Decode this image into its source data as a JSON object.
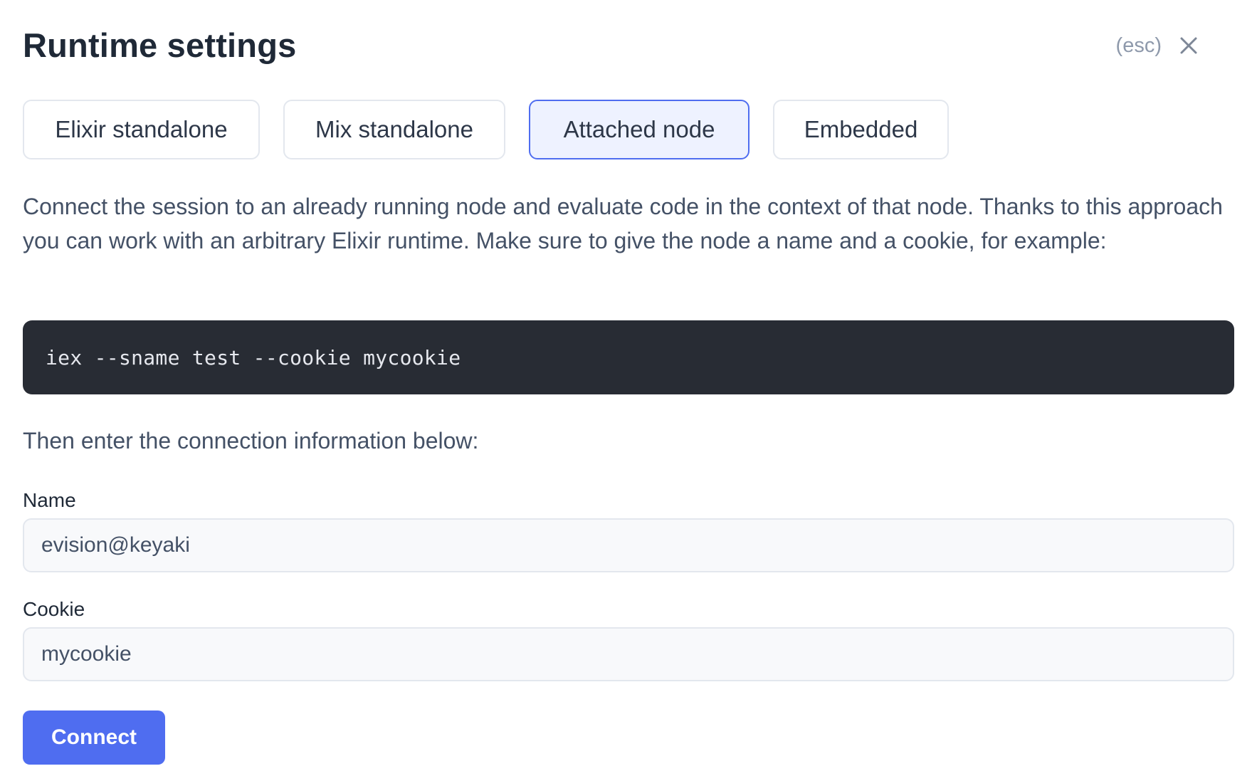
{
  "header": {
    "title": "Runtime settings",
    "esc_hint": "(esc)",
    "close_icon": "close-icon"
  },
  "tabs": [
    {
      "label": "Elixir standalone",
      "active": false
    },
    {
      "label": "Mix standalone",
      "active": false
    },
    {
      "label": "Attached node",
      "active": true
    },
    {
      "label": "Embedded",
      "active": false
    }
  ],
  "content": {
    "description": "Connect the session to an already running node and evaluate code in the context of that node. Thanks to this approach you can work with an arbitrary Elixir runtime. Make sure to give the node a name and a cookie, for example:",
    "code": "iex --sname test --cookie mycookie",
    "then_text": "Then enter the connection information below:"
  },
  "form": {
    "name_label": "Name",
    "name_value": "evision@keyaki",
    "cookie_label": "Cookie",
    "cookie_value": "mycookie",
    "connect_label": "Connect"
  },
  "colors": {
    "accent": "#4f6df0",
    "active_tab_bg": "#eef2ff",
    "code_bg": "#282c34",
    "title": "#1f2937",
    "body_text": "#445166"
  }
}
